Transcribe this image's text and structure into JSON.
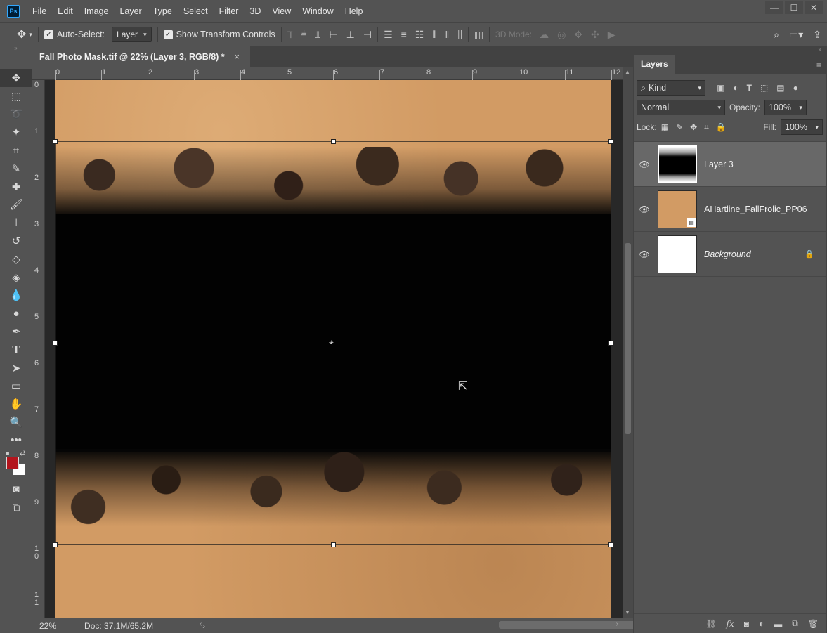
{
  "app": {
    "logo": "Ps"
  },
  "menu": [
    "File",
    "Edit",
    "Image",
    "Layer",
    "Type",
    "Select",
    "Filter",
    "3D",
    "View",
    "Window",
    "Help"
  ],
  "options_bar": {
    "auto_select_label": "Auto-Select:",
    "auto_select_value": "Layer",
    "show_transform_label": "Show Transform Controls",
    "three_d_mode_label": "3D Mode:"
  },
  "document": {
    "tab_title": "Fall Photo Mask.tif @ 22% (Layer 3, RGB/8) *",
    "close_glyph": "×"
  },
  "ruler": {
    "top": [
      "0",
      "1",
      "2",
      "3",
      "4",
      "5",
      "6",
      "7",
      "8",
      "9",
      "10",
      "11",
      "12"
    ],
    "left": [
      "0",
      "1",
      "2",
      "3",
      "4",
      "5",
      "6",
      "7",
      "8",
      "9",
      "1\n0",
      "1\n1"
    ]
  },
  "status": {
    "zoom": "22%",
    "doc": "Doc: 37.1M/65.2M"
  },
  "layers_panel": {
    "tab": "Layers",
    "kind_label": "Kind",
    "blend_mode": "Normal",
    "opacity_label": "Opacity:",
    "opacity_value": "100%",
    "lock_label": "Lock:",
    "fill_label": "Fill:",
    "fill_value": "100%",
    "layers": [
      {
        "name": "Layer 3",
        "selected": true
      },
      {
        "name": "AHartline_FallFrolic_PP06",
        "selected": false
      },
      {
        "name": "Background",
        "selected": false
      }
    ]
  },
  "colors": {
    "foreground": "#b3151d",
    "background": "#ffffff",
    "canvas_tan": "#d29b64",
    "panel_gray": "#535353"
  }
}
